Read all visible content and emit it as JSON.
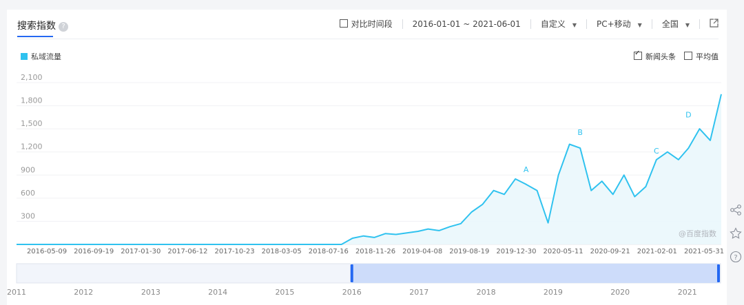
{
  "header": {
    "title": "搜索指数",
    "help_glyph": "?",
    "compare_label": "对比时间段",
    "date_range": "2016-01-01 ~ 2021-06-01",
    "custom_label": "自定义",
    "device_label": "PC+移动",
    "region_label": "全国"
  },
  "legend": {
    "label": "私域流量",
    "color": "#2fc2ef"
  },
  "options": {
    "news_label": "新闻头条",
    "avg_label": "平均值"
  },
  "watermark": "@百度指数",
  "chart_data": {
    "type": "area",
    "color": "#2fc2ef",
    "ylim": [
      0,
      2100
    ],
    "yticks": [
      "300",
      "600",
      "900",
      "1,200",
      "1,500",
      "1,800",
      "2,100"
    ],
    "ytick_values": [
      300,
      600,
      900,
      1200,
      1500,
      1800,
      2100
    ],
    "xticks": [
      "2016-05-09",
      "2016-09-19",
      "2017-01-30",
      "2017-06-12",
      "2017-10-23",
      "2018-03-05",
      "2018-07-16",
      "2018-11-26",
      "2019-04-08",
      "2019-08-19",
      "2019-12-30",
      "2020-05-11",
      "2020-09-21",
      "2021-02-01",
      "2021-05-31"
    ],
    "x": [
      "2016-01-01",
      "2018-07-01",
      "2018-08-01",
      "2018-09-01",
      "2018-10-01",
      "2018-11-01",
      "2018-12-01",
      "2019-01-01",
      "2019-02-01",
      "2019-03-01",
      "2019-04-01",
      "2019-05-01",
      "2019-06-01",
      "2019-07-01",
      "2019-08-01",
      "2019-09-01",
      "2019-10-01",
      "2019-11-01",
      "2019-12-01",
      "2020-01-01",
      "2020-02-01",
      "2020-03-01",
      "2020-04-01",
      "2020-05-01",
      "2020-06-01",
      "2020-07-01",
      "2020-08-01",
      "2020-09-01",
      "2020-10-01",
      "2020-11-01",
      "2020-12-01",
      "2021-01-01",
      "2021-02-01",
      "2021-03-01",
      "2021-04-01",
      "2021-05-01",
      "2021-06-01"
    ],
    "values": [
      0,
      0,
      80,
      110,
      90,
      140,
      130,
      150,
      170,
      200,
      180,
      230,
      270,
      420,
      520,
      700,
      650,
      850,
      780,
      700,
      280,
      900,
      1300,
      1250,
      700,
      820,
      650,
      900,
      620,
      750,
      1100,
      1200,
      1100,
      1250,
      1500,
      1350,
      1950
    ],
    "annotations": [
      {
        "label": "A",
        "x": "2019-12-01",
        "y": 850
      },
      {
        "label": "B",
        "x": "2020-05-01",
        "y": 1330
      },
      {
        "label": "C",
        "x": "2020-12-01",
        "y": 1090
      },
      {
        "label": "D",
        "x": "2021-03-01",
        "y": 1560
      }
    ]
  },
  "navigator": {
    "years": [
      "2011",
      "2012",
      "2013",
      "2014",
      "2015",
      "2016",
      "2017",
      "2018",
      "2019",
      "2020",
      "2021"
    ],
    "selection_start": "2016",
    "selection_end": "2021-06"
  },
  "side_icons": [
    "share-icon",
    "star-icon",
    "help-circle-icon"
  ]
}
